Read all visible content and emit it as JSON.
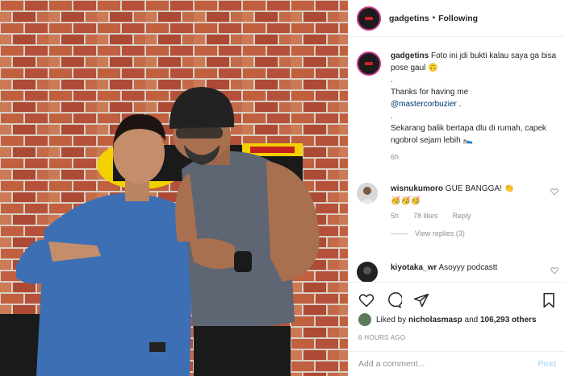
{
  "header": {
    "username": "gadgetins",
    "separator": "•",
    "follow_state": "Following"
  },
  "caption": {
    "username": "gadgetins",
    "line1": "Foto ini jdi bukti kalau saya ga bisa pose gaul",
    "line1_emoji": "🙃",
    "dot1": ".",
    "thanks": "Thanks for having me",
    "mention": "@mastercorbuzier",
    "mention_suffix": " .",
    "dot2": ".",
    "line3": "Sekarang balik bertapa dlu di rumah, capek ngobrol sejam lebih",
    "line3_emoji": "🛌",
    "time": "6h"
  },
  "comments": [
    {
      "username": "wisnukumoro",
      "text": "GUE BANGGA!",
      "emoji_after": "👏",
      "line2": "🥳🥳🥳",
      "time": "5h",
      "likes": "78 likes",
      "reply": "Reply",
      "view_replies": "View replies (3)"
    },
    {
      "username": "kiyotaka_wr",
      "text": "Asoyyy podcastt"
    }
  ],
  "likes": {
    "prefix": "Liked by",
    "user": "nicholasmasp",
    "middle": "and",
    "count": "106,293 others"
  },
  "posted_ago": "6 HOURS AGO",
  "add_comment": {
    "placeholder": "Add a comment...",
    "post_label": "Post"
  },
  "colors": {
    "brick": "#b7573c",
    "link": "#00376b",
    "muted": "#8e8e8e",
    "post_disabled": "#b2dffc"
  }
}
